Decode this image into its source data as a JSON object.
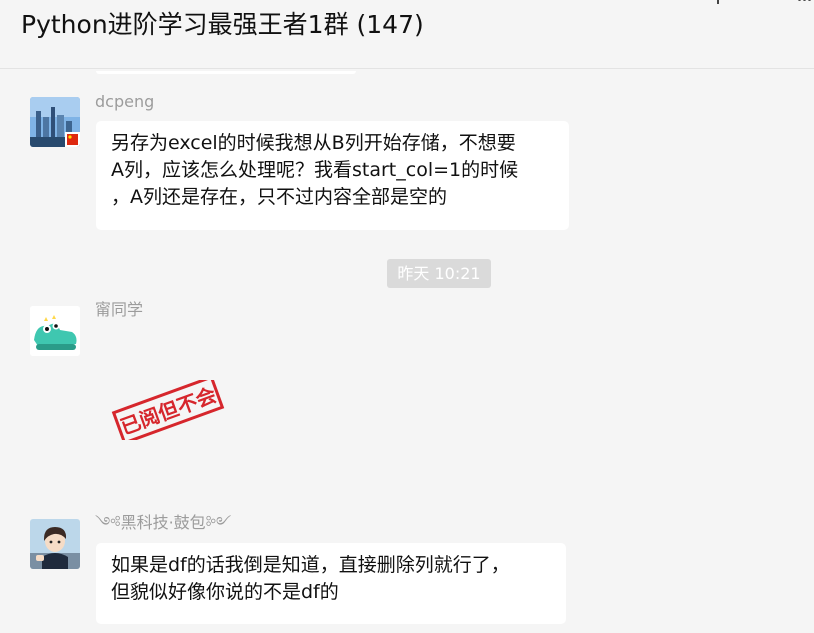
{
  "header": {
    "title": "Python进阶学习最强王者1群 (147)"
  },
  "messages": [
    {
      "sender": "dcpeng",
      "text": "另存为excel的时候我想从B列开始存储，不想要\nA列，应该怎么处理呢？我看start_col=1的时候\n，A列还是存在，只不过内容全部是空的"
    },
    {
      "timestamp": "昨天 10:21"
    },
    {
      "sender": "甯同学",
      "sticker_text": "已阅但不会"
    },
    {
      "sender": "༺黑科技·鼓包༻",
      "text": "如果是df的话我倒是知道，直接删除列就行了，\n但貌似好像你说的不是df的"
    }
  ],
  "colors": {
    "background": "#f5f5f5",
    "bubble": "#ffffff",
    "stamp_red": "#d6262c",
    "meta_text": "#9c9c9c"
  }
}
